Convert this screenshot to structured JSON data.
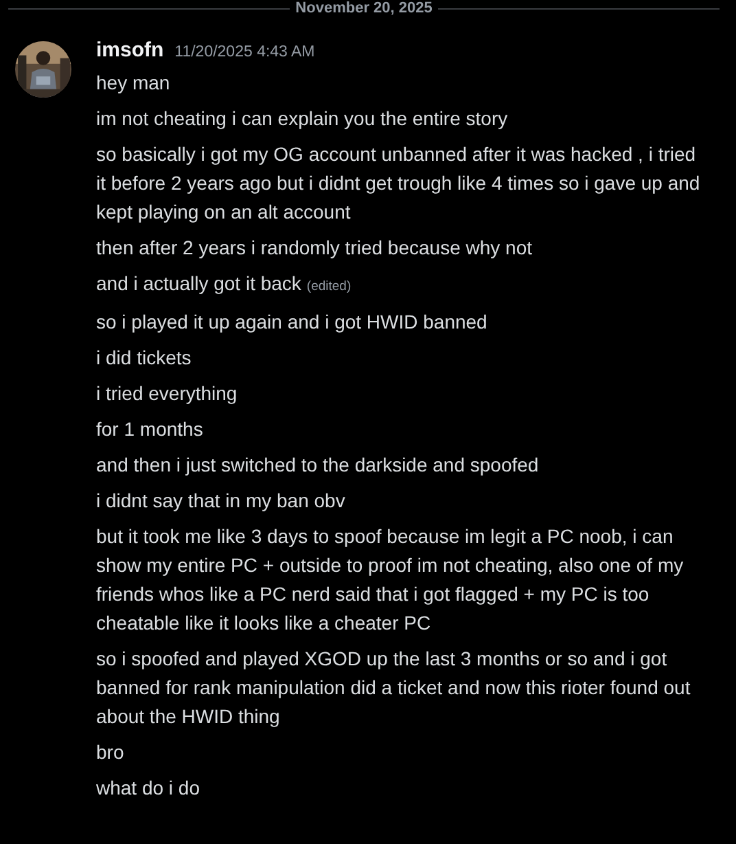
{
  "divider": {
    "date": "November 20, 2025"
  },
  "message": {
    "author": "imsofn",
    "timestamp": "11/20/2025 4:43 AM",
    "lines": [
      {
        "text": "hey man"
      },
      {
        "text": "im not cheating i can explain you the entire story"
      },
      {
        "text": "so basically i got my OG account unbanned after it was hacked , i tried it before 2 years ago but i didnt get trough like 4 times so i gave up and kept playing on an alt account"
      },
      {
        "text": "then after 2 years i randomly tried because why not"
      },
      {
        "text": "and i actually got it back",
        "edited_label": "(edited)"
      },
      {
        "text": "so i played it up again and i got HWID banned"
      },
      {
        "text": "i did tickets"
      },
      {
        "text": "i tried everything"
      },
      {
        "text": "for 1 months"
      },
      {
        "text": "and then i just switched to the darkside and spoofed"
      },
      {
        "text": "i didnt say that in my ban obv"
      },
      {
        "text": "but it took me like 3 days to spoof because im legit a PC noob, i can show my entire PC + outside to proof im not cheating, also one of my friends whos like a PC nerd said that i got flagged + my PC is too cheatable like it looks like a cheater PC"
      },
      {
        "text": "so i spoofed and played XGOD up the last 3 months or so and i got banned for rank manipulation did a ticket and now this rioter found out about the HWID thing"
      },
      {
        "text": "bro"
      },
      {
        "text": "what do i do"
      }
    ]
  }
}
